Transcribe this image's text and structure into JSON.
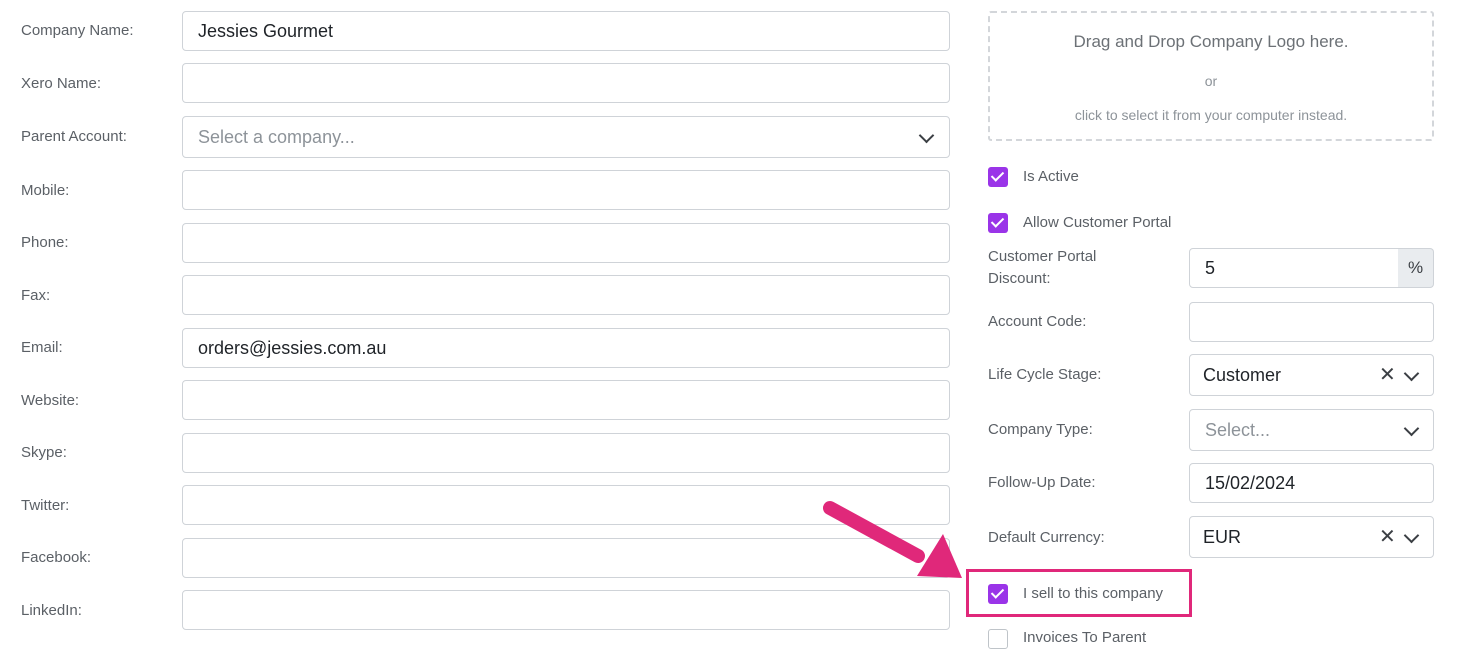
{
  "left_form": {
    "fields": [
      {
        "label": "Company Name:",
        "value": "Jessies Gourmet",
        "placeholder": ""
      },
      {
        "label": "Xero Name:",
        "value": "",
        "placeholder": ""
      },
      {
        "label": "Parent Account:",
        "value": "",
        "placeholder": "Select a company..."
      },
      {
        "label": "Mobile:",
        "value": "",
        "placeholder": ""
      },
      {
        "label": "Phone:",
        "value": "",
        "placeholder": ""
      },
      {
        "label": "Fax:",
        "value": "",
        "placeholder": ""
      },
      {
        "label": "Email:",
        "value": "orders@jessies.com.au",
        "placeholder": ""
      },
      {
        "label": "Website:",
        "value": "",
        "placeholder": ""
      },
      {
        "label": "Skype:",
        "value": "",
        "placeholder": ""
      },
      {
        "label": "Twitter:",
        "value": "",
        "placeholder": ""
      },
      {
        "label": "Facebook:",
        "value": "",
        "placeholder": ""
      },
      {
        "label": "LinkedIn:",
        "value": "",
        "placeholder": ""
      }
    ]
  },
  "logo_dropzone": {
    "title": "Drag and Drop Company Logo here.",
    "or": "or",
    "subtitle": "click to select it from your computer instead."
  },
  "right_form": {
    "is_active": {
      "label": "Is Active",
      "checked": true
    },
    "allow_portal": {
      "label": "Allow Customer Portal",
      "checked": true
    },
    "portal_discount": {
      "label_line1": "Customer Portal",
      "label_line2": "Discount:",
      "value": "5",
      "unit": "%"
    },
    "account_code": {
      "label": "Account Code:",
      "value": ""
    },
    "life_cycle": {
      "label": "Life Cycle Stage:",
      "value": "Customer"
    },
    "company_type": {
      "label": "Company Type:",
      "placeholder": "Select..."
    },
    "follow_up": {
      "label": "Follow-Up Date:",
      "value": "15/02/2024"
    },
    "currency": {
      "label": "Default Currency:",
      "value": "EUR"
    },
    "sell_to": {
      "label": "I sell to this company",
      "checked": true
    },
    "invoices_to_parent": {
      "label": "Invoices To Parent",
      "checked": false
    }
  },
  "annotation": {
    "color": "#e0287a"
  },
  "colors": {
    "accent": "#9a34e8",
    "border": "#cfd3d8"
  }
}
